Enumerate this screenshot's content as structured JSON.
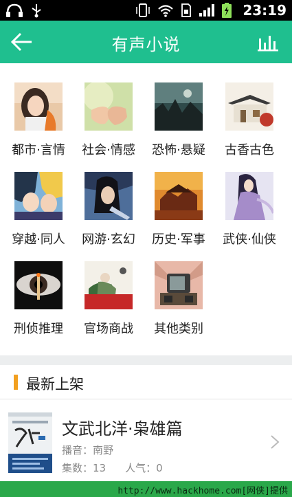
{
  "status_bar": {
    "time": "23:19",
    "icons": [
      "headset-icon",
      "usb-icon",
      "vibrate-icon",
      "wifi-icon",
      "sim-icon",
      "signal-icon",
      "battery-charging-icon"
    ]
  },
  "header": {
    "title": "有声小说",
    "back_icon": "arrow-left-icon",
    "rank_icon": "bar-chart-icon",
    "color": "#1fbf8f"
  },
  "categories": [
    {
      "label": "都市·言情"
    },
    {
      "label": "社会·情感"
    },
    {
      "label": "恐怖·悬疑"
    },
    {
      "label": "古香古色"
    },
    {
      "label": "穿越·同人"
    },
    {
      "label": "网游·玄幻"
    },
    {
      "label": "历史·军事"
    },
    {
      "label": "武侠·仙侠"
    },
    {
      "label": "刑侦推理"
    },
    {
      "label": "官场商战"
    },
    {
      "label": "其他类别"
    }
  ],
  "section": {
    "title": "最新上架",
    "accent": "#f2a020"
  },
  "books": [
    {
      "title": "文武北洋·枭雄篇",
      "author": "播音：南野",
      "episodes": "集数：13",
      "popularity": "人气：0"
    }
  ],
  "watermark": {
    "text": "http://www.hackhome.com[网侠]提供"
  }
}
